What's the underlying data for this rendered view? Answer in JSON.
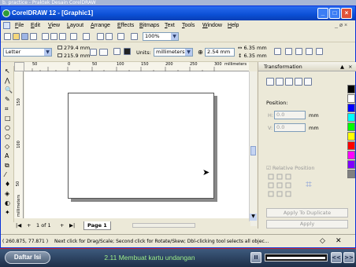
{
  "background_window_title": "b. practice - Praktek Desain CorelDRAW",
  "app": {
    "title": "CorelDRAW 12 - [Graphic1]",
    "window_controls": [
      "minimize-icon",
      "maximize-icon",
      "close-icon"
    ]
  },
  "menu": [
    "File",
    "Edit",
    "View",
    "Layout",
    "Arrange",
    "Effects",
    "Bitmaps",
    "Text",
    "Tools",
    "Window",
    "Help"
  ],
  "menu_right": "_ ø ×",
  "standard_toolbar": {
    "zoom": "100%"
  },
  "property_bar": {
    "paper_size": "Letter",
    "width": "279.4 mm",
    "height": "215.9 mm",
    "units_label": "Units:",
    "units": "millimeters",
    "nudge": "2.54 mm",
    "dup_x": "6.35 mm",
    "dup_y": "6.35 mm"
  },
  "ruler": {
    "h_ticks": [
      "50",
      "0",
      "50",
      "100",
      "150",
      "200",
      "250",
      "300"
    ],
    "h_unit": "millimeters",
    "v_ticks": [
      "150",
      "100",
      "50"
    ],
    "v_unit": "millimeters"
  },
  "page_nav": {
    "first": "|◀",
    "prev": "+",
    "position": "1 of 1",
    "next": "+",
    "last": "▶|",
    "tab": "Page 1"
  },
  "docker": {
    "title": "Transformation",
    "position_label": "Position:",
    "h_label": "H:",
    "h_value": "0.0",
    "v_label": "V:",
    "v_value": "0.0",
    "unit": "mm",
    "relative_position": "Relative Position",
    "apply_duplicate": "Apply To Duplicate",
    "apply": "Apply"
  },
  "palette_colors": [
    "#000000",
    "#ffffff",
    "#0000ff",
    "#00ffff",
    "#00ff00",
    "#ffff00",
    "#ff0000",
    "#ff00ff",
    "#8000ff",
    "#808080"
  ],
  "status": {
    "coords": "( 260.875, 77.871 )",
    "hint": "Next click for Drag/Scale; Second click for Rotate/Skew; Dbl-clicking tool selects all objec..."
  },
  "player": {
    "index_button": "Daftar Isi",
    "lesson": "2.11 Membuat kartu undangan",
    "pause": "II",
    "prev": "<<",
    "next": ">>"
  }
}
